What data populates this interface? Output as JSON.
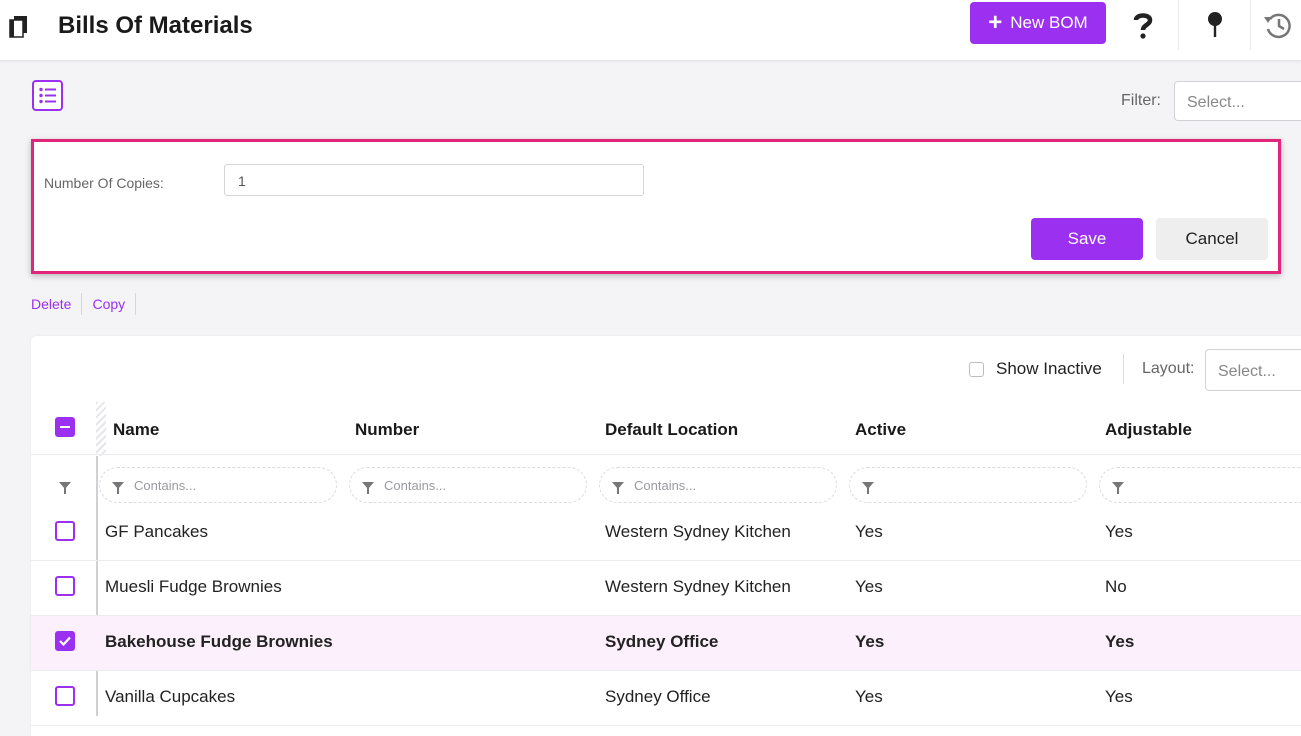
{
  "header": {
    "title": "Bills Of Materials",
    "new_button_label": "New BOM",
    "icons": [
      "app-doc-icon",
      "help-icon",
      "pin-icon",
      "history-icon"
    ]
  },
  "toolbar": {
    "filter_label": "Filter:",
    "filter_placeholder": "Select..."
  },
  "copy_panel": {
    "copies_label": "Number Of Copies:",
    "copies_value": "1",
    "save_label": "Save",
    "cancel_label": "Cancel",
    "highlight_color": "#e0267a"
  },
  "actions": {
    "delete_label": "Delete",
    "copy_label": "Copy"
  },
  "grid": {
    "show_inactive_label": "Show Inactive",
    "show_inactive_checked": false,
    "layout_label": "Layout:",
    "layout_placeholder": "Select...",
    "columns": [
      "Name",
      "Number",
      "Default Location",
      "Active",
      "Adjustable"
    ],
    "filter_placeholders": [
      "Contains...",
      "Contains...",
      "Contains...",
      "",
      ""
    ],
    "rows": [
      {
        "name": "GF Pancakes",
        "number": "",
        "location": "Western Sydney Kitchen",
        "active": "Yes",
        "adjustable": "Yes",
        "selected": false
      },
      {
        "name": "Muesli Fudge Brownies",
        "number": "",
        "location": "Western Sydney Kitchen",
        "active": "Yes",
        "adjustable": "No",
        "selected": false
      },
      {
        "name": "Bakehouse Fudge Brownies",
        "number": "",
        "location": "Sydney Office",
        "active": "Yes",
        "adjustable": "Yes",
        "selected": true
      },
      {
        "name": "Vanilla Cupcakes",
        "number": "",
        "location": "Sydney Office",
        "active": "Yes",
        "adjustable": "Yes",
        "selected": false
      }
    ]
  },
  "colors": {
    "accent": "#9b30f0",
    "selected_row_bg": "#fdf0fd"
  }
}
